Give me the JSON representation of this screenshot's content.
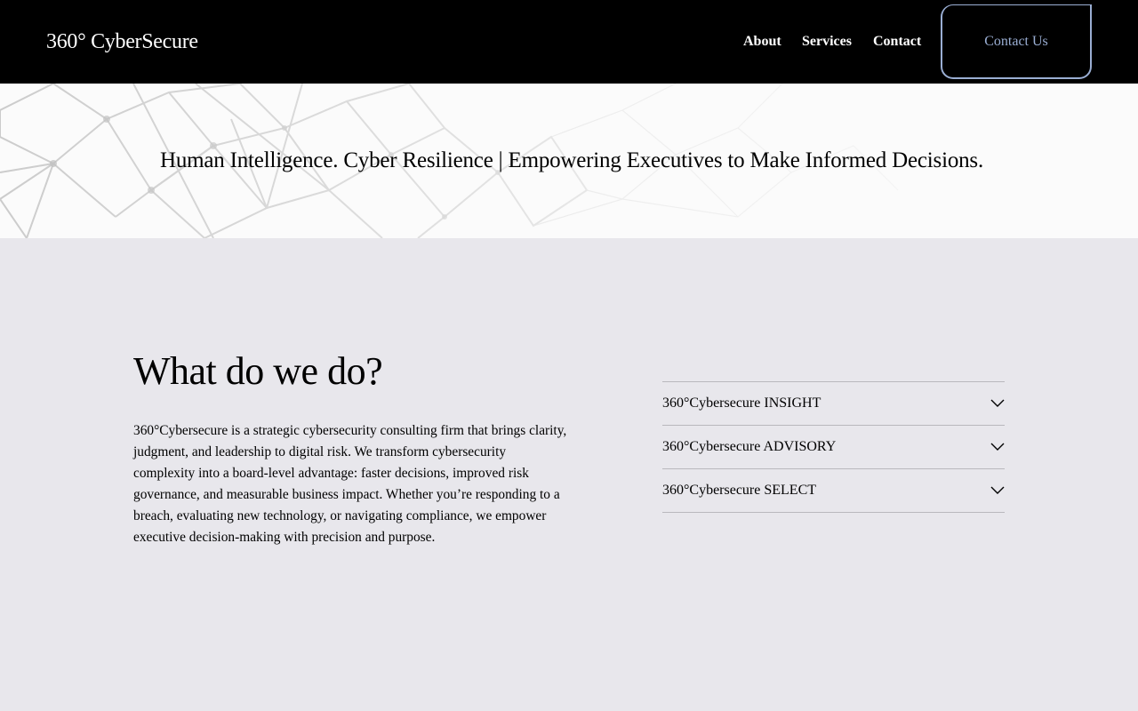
{
  "header": {
    "logo": "360° CyberSecure",
    "nav": {
      "about": "About",
      "services": "Services",
      "contact": "Contact"
    },
    "cta_label": "Contact Us"
  },
  "hero": {
    "tagline": "Human Intelligence. Cyber Resilience | Empowering Executives to Make Informed Decisions."
  },
  "about_section": {
    "title": "What do we do?",
    "body": "360°Cybersecure is a strategic cybersecurity consulting firm that brings clarity, judgment, and leadership to digital risk. We transform cybersecurity complexity into a board-level advantage: faster decisions, improved risk governance, and measurable business impact. Whether you’re responding to a breach, evaluating new technology, or navigating compliance, we empower executive decision-making with precision and purpose."
  },
  "services_accordion": {
    "items": [
      {
        "label": "360°Cybersecure INSIGHT",
        "icon": "chevron-down-icon"
      },
      {
        "label": "360°Cybersecure ADVISORY",
        "icon": "chevron-down-icon"
      },
      {
        "label": "360°Cybersecure SELECT",
        "icon": "chevron-down-icon"
      }
    ]
  },
  "colors": {
    "header_bg": "#000000",
    "page_bg": "#e8e7ec",
    "cta_accent": "#9aaed3",
    "divider": "#b9b8bd"
  }
}
